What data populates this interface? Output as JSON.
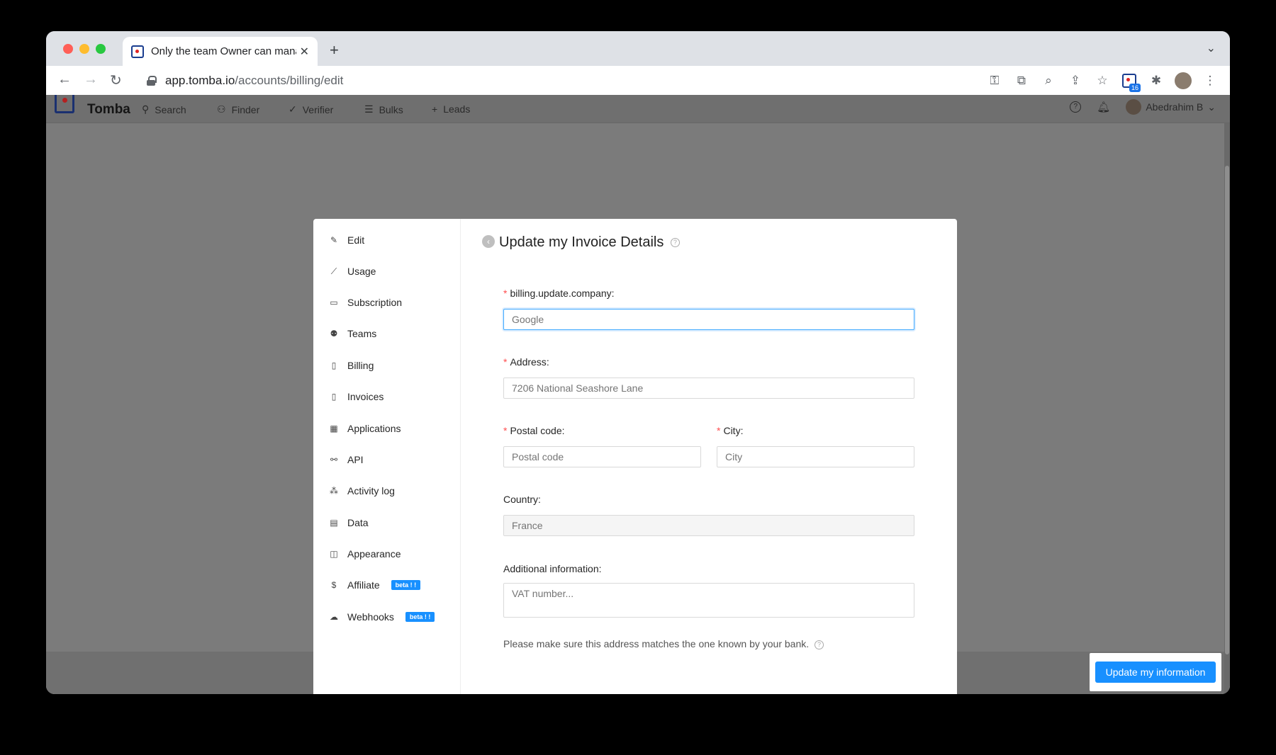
{
  "browser": {
    "tab_title": "Only the team Owner can manage",
    "url_host": "app.tomba.io",
    "url_path": "/accounts/billing/edit",
    "extension_badge": "16"
  },
  "header": {
    "brand": "Tomba",
    "nav": [
      {
        "label": "Search",
        "icon": "search-icon"
      },
      {
        "label": "Finder",
        "icon": "person-icon"
      },
      {
        "label": "Verifier",
        "icon": "check-icon"
      },
      {
        "label": "Bulks",
        "icon": "list-icon"
      },
      {
        "label": "Leads",
        "icon": "plus-icon"
      }
    ],
    "user_name": "Abedrahim B"
  },
  "sidebar": {
    "items": [
      {
        "label": "Edit",
        "icon": "edit-icon"
      },
      {
        "label": "Usage",
        "icon": "chart-line-icon"
      },
      {
        "label": "Subscription",
        "icon": "card-icon"
      },
      {
        "label": "Teams",
        "icon": "team-icon"
      },
      {
        "label": "Billing",
        "icon": "file-icon"
      },
      {
        "label": "Invoices",
        "icon": "document-icon"
      },
      {
        "label": "Applications",
        "icon": "apps-icon"
      },
      {
        "label": "API",
        "icon": "api-icon"
      },
      {
        "label": "Activity log",
        "icon": "cluster-icon"
      },
      {
        "label": "Data",
        "icon": "database-icon"
      },
      {
        "label": "Appearance",
        "icon": "layout-icon"
      },
      {
        "label": "Affiliate",
        "icon": "dollar-icon",
        "badge": "beta ! !"
      },
      {
        "label": "Webhooks",
        "icon": "cloud-icon",
        "badge": "beta ! !"
      }
    ]
  },
  "form": {
    "title": "Update my Invoice Details",
    "company_label": "billing.update.company",
    "company_placeholder": "Google",
    "address_label": "Address",
    "address_placeholder": "7206 National Seashore Lane",
    "postal_label": "Postal code",
    "postal_placeholder": "Postal code",
    "city_label": "City",
    "city_placeholder": "City",
    "country_label": "Country",
    "country_value": "France",
    "additional_label": "Additional information",
    "additional_placeholder": "VAT number...",
    "note": "Please make sure this address matches the one known by your bank."
  },
  "actions": {
    "update_label": "Update my information"
  },
  "colors": {
    "primary": "#1890ff",
    "required": "#ff4d4f"
  }
}
